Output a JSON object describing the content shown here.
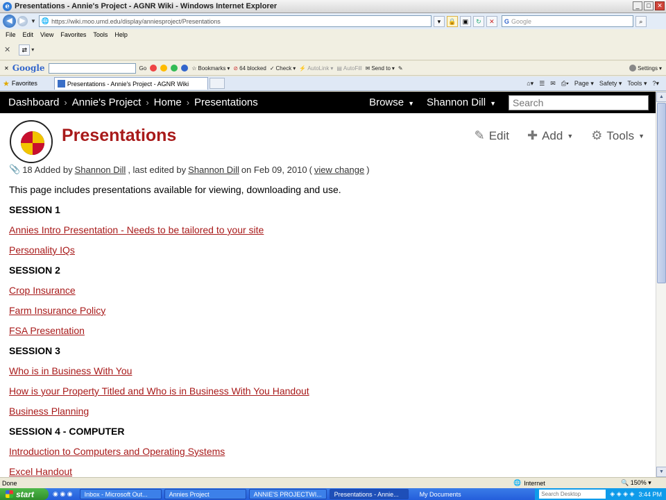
{
  "window": {
    "title": "Presentations - Annie's Project - AGNR Wiki - Windows Internet Explorer",
    "url": "https://wiki.moo.umd.edu/display/anniesproject/Presentations",
    "search_placeholder": "Google"
  },
  "menubar": [
    "File",
    "Edit",
    "View",
    "Favorites",
    "Tools",
    "Help"
  ],
  "google_toolbar": {
    "logo": "Google",
    "go": "Go",
    "bookmarks": "Bookmarks",
    "blocked": "64 blocked",
    "check": "Check",
    "autolink": "AutoLink",
    "autofill": "AutoFill",
    "send_to": "Send to",
    "settings": "Settings"
  },
  "tabs": {
    "favorites": "Favorites",
    "active_tab": "Presentations - Annie's Project - AGNR Wiki",
    "commands": [
      "Page",
      "Safety",
      "Tools"
    ]
  },
  "wiki": {
    "breadcrumbs": [
      "Dashboard",
      "Annie's Project",
      "Home",
      "Presentations"
    ],
    "browse": "Browse",
    "user": "Shannon Dill",
    "search_placeholder": "Search",
    "page_title": "Presentations",
    "actions": {
      "edit": "Edit",
      "add": "Add",
      "tools": "Tools"
    },
    "meta": {
      "attachments": "18",
      "added_by": "Added by",
      "author": "Shannon Dill",
      "last_edited_by": ", last edited by",
      "editor": "Shannon Dill",
      "on_date": "on Feb 09, 2010",
      "open_paren": "(",
      "view_change": "view change",
      "close_paren": ")"
    },
    "intro": "This page includes presentations available for viewing, downloading and use.",
    "content": [
      {
        "type": "heading",
        "text": "SESSION 1"
      },
      {
        "type": "link",
        "text": "Annies Intro Presentation - Needs to be tailored to your site"
      },
      {
        "type": "link",
        "text": "Personality IQs"
      },
      {
        "type": "heading",
        "text": "SESSION 2"
      },
      {
        "type": "link",
        "text": "Crop Insurance"
      },
      {
        "type": "link",
        "text": "Farm Insurance Policy"
      },
      {
        "type": "link",
        "text": "FSA Presentation"
      },
      {
        "type": "heading",
        "text": "SESSION 3"
      },
      {
        "type": "link",
        "text": "Who is in Business With You"
      },
      {
        "type": "link",
        "text": "How is your Property Titled and Who is in Business With You Handout"
      },
      {
        "type": "link",
        "text": "Business Planning"
      },
      {
        "type": "heading",
        "text": "SESSION 4 - COMPUTER"
      },
      {
        "type": "link",
        "text": "Introduction to Computers and Operating Systems"
      },
      {
        "type": "link",
        "text": "Excel Handout"
      }
    ]
  },
  "statusbar": {
    "left": "Done",
    "zone": "Internet",
    "zoom": "150%"
  },
  "taskbar": {
    "start": "start",
    "tasks": [
      "Inbox - Microsoft Out...",
      "Annies Project",
      "ANNIE'S PROJECTWI...",
      "Presentations - Annie..."
    ],
    "my_documents": "My Documents",
    "desktop_search": "Search Desktop",
    "clock": "3:44 PM"
  },
  "colors": {
    "link": "#a81a1a",
    "title": "#a81a1a",
    "header_bg": "#000000",
    "taskbar": "#245edb"
  }
}
